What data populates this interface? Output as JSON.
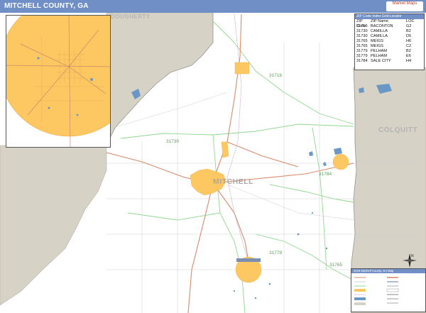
{
  "header": {
    "title": "MITCHELL COUNTY, GA",
    "logo_text": "Market Maps"
  },
  "colors": {
    "title_bar": "#6f8fc6",
    "urban_area": "#fdc862",
    "neighbor_county": "#d6d2c6",
    "zip_boundary": "#8fd88f",
    "highway": "#d88a6a",
    "water": "#6b97c7"
  },
  "counties": {
    "dougherty": "DOUGHERTY",
    "colquitt": "COLQUITT",
    "mitchell": "MITCHELL"
  },
  "zip_areas": [
    "31716",
    "31730",
    "31784",
    "31779",
    "31765"
  ],
  "zip_table": {
    "title": "ZIP Code Index Grid Locator",
    "headers": [
      "ZIP Code",
      "ZIP Name",
      "LOC"
    ],
    "rows": [
      [
        "31716",
        "BACONTON",
        "G2"
      ],
      [
        "31730",
        "CAMILLA",
        "B2"
      ],
      [
        "31730",
        "CAMILLA",
        "D5"
      ],
      [
        "31765",
        "MEIGS",
        "H6"
      ],
      [
        "31765",
        "MEIGS",
        "C2"
      ],
      [
        "31779",
        "PELHAM",
        "B2"
      ],
      [
        "31779",
        "PELHAM",
        "E6"
      ],
      [
        "31784",
        "SALE CITY",
        "H4"
      ]
    ]
  },
  "legend": {
    "title": "2019 Mitchell County, GA Map"
  },
  "compass": {
    "north_label": "N"
  }
}
